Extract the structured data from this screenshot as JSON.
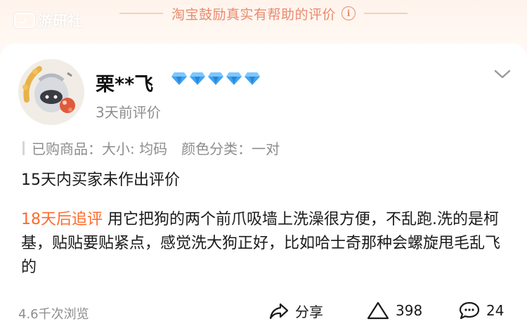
{
  "banner": {
    "text": "淘宝鼓励真实有帮助的评价"
  },
  "watermark": {
    "text": "游研社"
  },
  "review": {
    "user_name": "栗**飞",
    "membership_diamonds": 5,
    "time": "3天前评价",
    "product": {
      "label": "已购商品：",
      "size": "大小: 均码",
      "color": "颜色分类：一对"
    },
    "first_review": "15天内买家未作出评价",
    "followup_tag": "18天后追评",
    "followup_text": "用它把狗的两个前爪吸墙上洗澡很方便，不乱跑.洗的是柯基，贴贴要贴紧点，感觉洗大狗正好，比如哈士奇那种会螺旋甩毛乱飞的"
  },
  "footer": {
    "views": "4.6千次浏览",
    "share_label": "分享",
    "like_count": "398",
    "comment_count": "24"
  },
  "colors": {
    "accent_orange": "#ff6a2a",
    "banner_text": "#e98a6e",
    "diamond_blue": "#3fa2f0",
    "muted_text": "#8d8d8d"
  }
}
